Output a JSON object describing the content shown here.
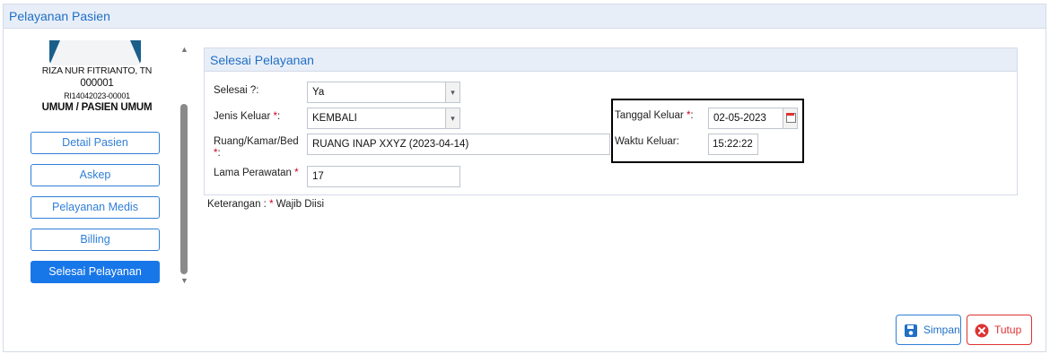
{
  "window": {
    "title": "Pelayanan Pasien"
  },
  "patient": {
    "name": "RIZA NUR FITRIANTO, TN",
    "number": "000001",
    "registration": "RI14042023-00001",
    "category": "UMUM / PASIEN UMUM"
  },
  "nav": {
    "items": [
      {
        "label": "Detail Pasien",
        "active": false
      },
      {
        "label": "Askep",
        "active": false
      },
      {
        "label": "Pelayanan Medis",
        "active": false
      },
      {
        "label": "Billing",
        "active": false
      },
      {
        "label": "Selesai Pelayanan",
        "active": true
      }
    ]
  },
  "form": {
    "title": "Selesai Pelayanan",
    "selesai": {
      "label": "Selesai ?:",
      "value": "Ya"
    },
    "jenis_keluar": {
      "label": "Jenis Keluar",
      "value": "KEMBALI"
    },
    "ruang": {
      "label": "Ruang/Kamar/Bed",
      "value": "RUANG INAP XXYZ (2023-04-14)"
    },
    "lama": {
      "label": "Lama Perawatan",
      "value": "17"
    },
    "tanggal_keluar": {
      "label": "Tanggal Keluar",
      "value": "02-05-2023"
    },
    "waktu_keluar": {
      "label": "Waktu Keluar:",
      "value": "15:22:22"
    },
    "required_mark": "*",
    "colon": ":"
  },
  "note": {
    "prefix": "Keterangan :",
    "mark": "*",
    "text": "Wajib Diisi"
  },
  "actions": {
    "save_label": "Simpan",
    "close_label": "Tutup"
  },
  "colors": {
    "accent": "#1877e8",
    "title": "#1f6fc5",
    "danger": "#d33333"
  }
}
